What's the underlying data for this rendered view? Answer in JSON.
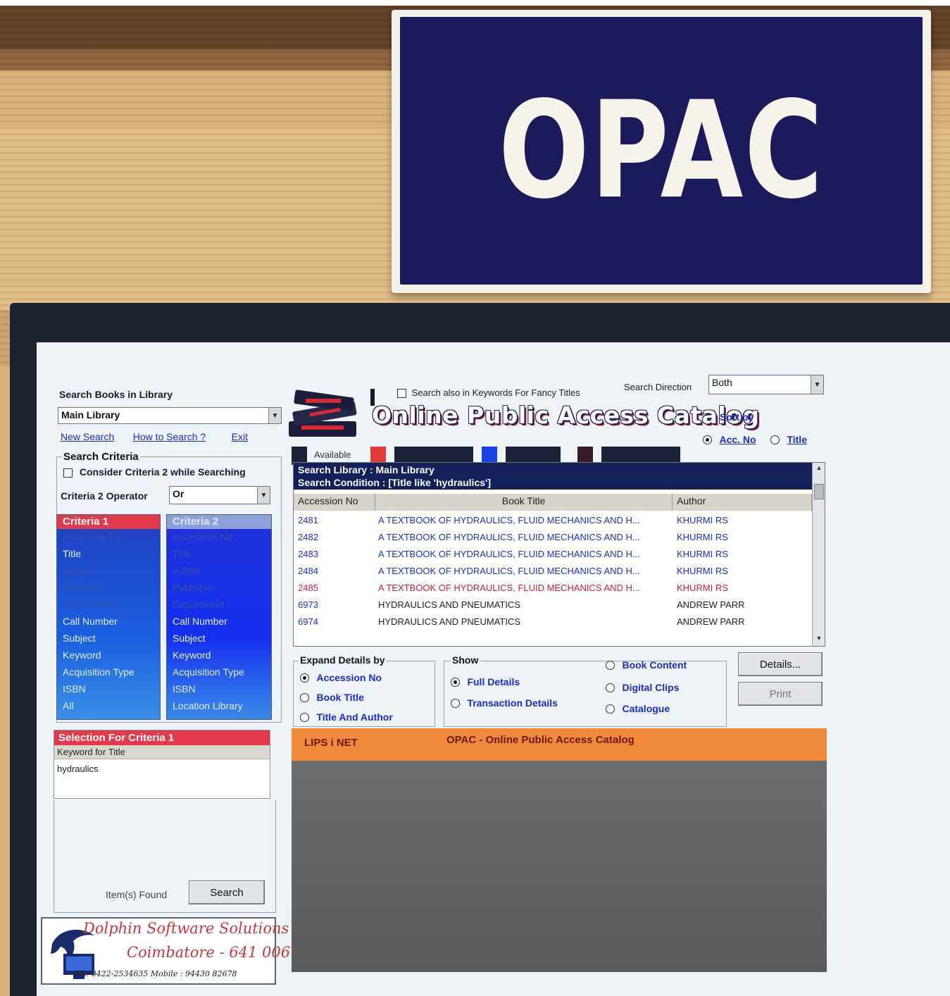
{
  "sign": {
    "text": "OPAC"
  },
  "app": {
    "search_books_label": "Search Books in Library",
    "library_select": "Main Library",
    "links": {
      "new_search": "New Search",
      "how_to_search": "How to Search ?",
      "exit": "Exit"
    },
    "search_criteria_title": "Search Criteria",
    "consider_criteria2": "Consider Criteria 2 while Searching",
    "criteria2_operator_label": "Criteria 2 Operator",
    "criteria2_operator_value": "Or",
    "criteria1": {
      "header": "Criteria 1",
      "items": [
        "Accession No",
        "Title",
        "Author",
        "Publisher",
        "Department",
        "Call Number",
        "Subject",
        "Keyword",
        "Acquisition Type",
        "ISBN",
        "All"
      ]
    },
    "criteria2": {
      "header": "Criteria 2",
      "items": [
        "Accession No",
        "Title",
        "Author",
        "Publisher",
        "Department",
        "Call Number",
        "Subject",
        "Keyword",
        "Acquisition Type",
        "ISBN",
        "Location Library"
      ]
    },
    "selection": {
      "header": "Selection For Criteria 1",
      "sub": "Keyword for Title",
      "value": "hydraulics"
    },
    "items_found_label": "Item(s) Found",
    "search_button": "Search",
    "vendor": {
      "name": "Dolphin Software Solutions",
      "city": "Coimbatore - 641 006",
      "contact": "Ph: 0422-2534635  Mobile : 94430 82678"
    },
    "also_keywords": "Search also in Keywords For Fancy Titles",
    "search_direction_label": "Search Direction",
    "search_direction_value": "Both",
    "catalog_title": "Online Public Access Catalog",
    "sort_by_label": "Sort by",
    "sort_options": {
      "acc_no": "Acc. No",
      "title": "Title"
    },
    "legend": {
      "available": "Available"
    },
    "colors": {
      "available": "#1a2138",
      "issued": "#e23a3a",
      "reserved": "#1a40e0",
      "other": "#3a1a2a"
    },
    "results": {
      "search_library_line": "Search Library     : Main Library",
      "search_condition_line": "Search Condition : [Title like 'hydraulics']",
      "columns": {
        "accession": "Accession No",
        "title": "Book Title",
        "author": "Author"
      },
      "rows": [
        {
          "acc": "2481",
          "title": "A TEXTBOOK OF HYDRAULICS, FLUID MECHANICS AND H...",
          "author": "KHURMI RS",
          "style": "blue"
        },
        {
          "acc": "2482",
          "title": "A TEXTBOOK OF HYDRAULICS, FLUID MECHANICS AND H...",
          "author": "KHURMI RS",
          "style": "blue"
        },
        {
          "acc": "2483",
          "title": "A TEXTBOOK OF HYDRAULICS, FLUID MECHANICS AND H...",
          "author": "KHURMI RS",
          "style": "blue"
        },
        {
          "acc": "2484",
          "title": "A TEXTBOOK OF HYDRAULICS, FLUID MECHANICS AND H...",
          "author": "KHURMI RS",
          "style": "blue"
        },
        {
          "acc": "2485",
          "title": "A TEXTBOOK OF HYDRAULICS, FLUID MECHANICS AND H...",
          "author": "KHURMI RS",
          "style": "red"
        },
        {
          "acc": "6973",
          "title": "HYDRAULICS AND PNEUMATICS",
          "author": "ANDREW PARR",
          "style": "black"
        },
        {
          "acc": "6974",
          "title": "HYDRAULICS AND PNEUMATICS",
          "author": "ANDREW PARR",
          "style": "black"
        }
      ]
    },
    "expand": {
      "title": "Expand Details by",
      "options": [
        "Accession No",
        "Book Title",
        "Title And Author"
      ],
      "selected": "Accession No"
    },
    "show": {
      "title": "Show",
      "options": [
        "Full Details",
        "Transaction Details",
        "Book Content",
        "Digital Clips",
        "Catalogue"
      ],
      "selected": "Full Details"
    },
    "details_button": "Details...",
    "print_button": "Print",
    "status_bar": {
      "left": "LIPS i NET",
      "center": "OPAC - Online Public Access Catalog"
    }
  }
}
